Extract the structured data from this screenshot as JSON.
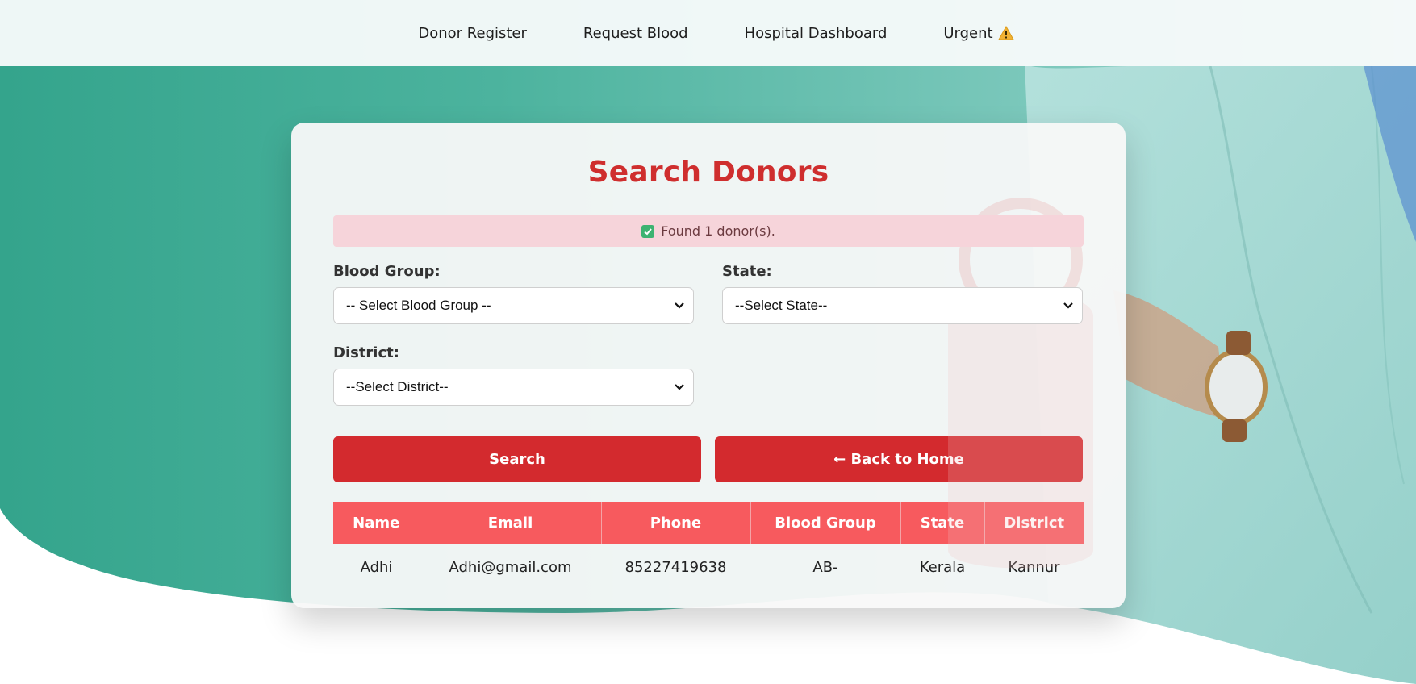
{
  "nav": {
    "items": [
      {
        "label": "Donor Register"
      },
      {
        "label": "Request Blood"
      },
      {
        "label": "Hospital Dashboard"
      },
      {
        "label": "Urgent"
      }
    ],
    "urgent_icon": "warning-icon"
  },
  "page": {
    "title": "Search Donors",
    "alert_text": "Found 1 donor(s).",
    "alert_icon": "check-icon"
  },
  "form": {
    "blood_group_label": "Blood Group:",
    "blood_group_value": "-- Select Blood Group --",
    "state_label": "State:",
    "state_value": "--Select State--",
    "district_label": "District:",
    "district_value": "--Select District--"
  },
  "buttons": {
    "search_label": "Search",
    "back_label": "← Back to Home"
  },
  "table": {
    "headers": [
      "Name",
      "Email",
      "Phone",
      "Blood Group",
      "State",
      "District"
    ],
    "rows": [
      [
        "Adhi",
        "Adhi@gmail.com",
        "85227419638",
        "AB-",
        "Kerala",
        "Kannur"
      ]
    ]
  },
  "colors": {
    "accent": "#cf2e2e",
    "button": "#d32a2e",
    "table_header": "#f75a5e",
    "alert_bg": "#f6d4da",
    "teal_bg": "#3ba893"
  }
}
